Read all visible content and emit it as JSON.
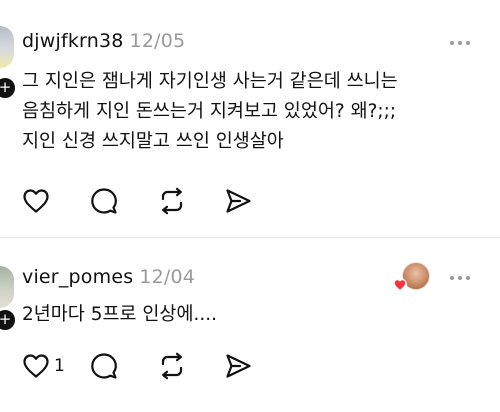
{
  "posts": [
    {
      "username": "djwjfkrn38",
      "timestamp": "12/05",
      "body": "그 지인은 잼나게 자기인생 사는거 같은데 쓰니는\n음침하게 지인 돈쓰는거 지켜보고 있었어? 왜?;;;\n지인 신경 쓰지말고 쓰인 인생살아",
      "avatar_badge": "+",
      "like_count": ""
    },
    {
      "username": "vier_pomes",
      "timestamp": "12/04",
      "body": "2년마다 5프로 인상에....",
      "avatar_badge": "+",
      "like_count": "1"
    }
  ],
  "icons": {
    "like": "heart-icon",
    "comment": "comment-icon",
    "repost": "repost-icon",
    "share": "send-icon",
    "more": "more-icon"
  },
  "colors": {
    "text": "#111111",
    "muted": "#9a9a9a",
    "divider": "#e6e6e6",
    "heart_red": "#ff3040"
  }
}
